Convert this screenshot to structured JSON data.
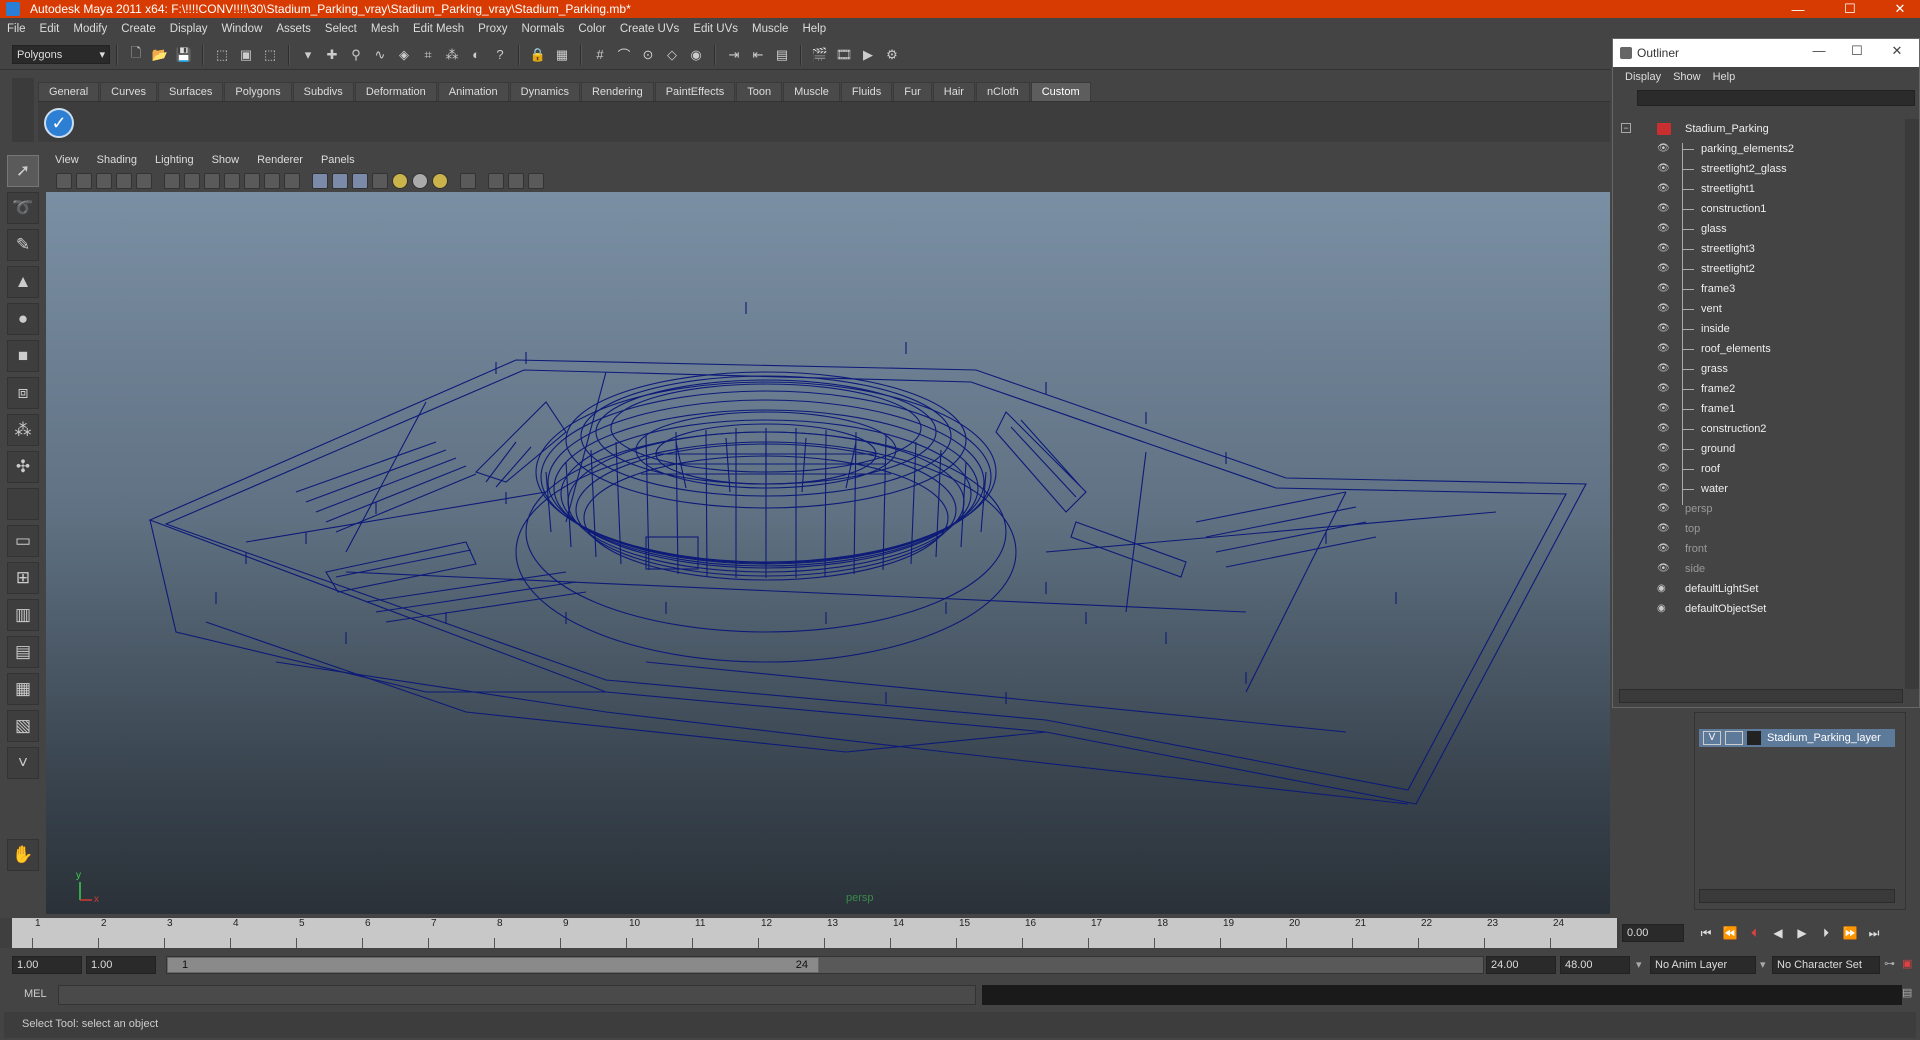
{
  "window": {
    "title": "Autodesk Maya 2011 x64: F:\\!!!!CONV!!!!\\30\\Stadium_Parking_vray\\Stadium_Parking_vray\\Stadium_Parking.mb*",
    "minimize": "—",
    "maximize": "☐",
    "close": "✕"
  },
  "menu": [
    "File",
    "Edit",
    "Modify",
    "Create",
    "Display",
    "Window",
    "Assets",
    "Select",
    "Mesh",
    "Edit Mesh",
    "Proxy",
    "Normals",
    "Color",
    "Create UVs",
    "Edit UVs",
    "Muscle",
    "Help"
  ],
  "status": {
    "mode": "Polygons"
  },
  "shelf": {
    "tabs": [
      "General",
      "Curves",
      "Surfaces",
      "Polygons",
      "Subdivs",
      "Deformation",
      "Animation",
      "Dynamics",
      "Rendering",
      "PaintEffects",
      "Toon",
      "Muscle",
      "Fluids",
      "Fur",
      "Hair",
      "nCloth",
      "Custom"
    ],
    "active": "Custom"
  },
  "panel": {
    "menu": [
      "View",
      "Shading",
      "Lighting",
      "Show",
      "Renderer",
      "Panels"
    ],
    "camera": "persp",
    "axis_y": "y",
    "axis_x": "x"
  },
  "timeline": {
    "ticks": [
      "1",
      "2",
      "3",
      "4",
      "5",
      "6",
      "7",
      "8",
      "9",
      "10",
      "11",
      "12",
      "13",
      "14",
      "15",
      "16",
      "17",
      "18",
      "19",
      "20",
      "21",
      "22",
      "23",
      "24"
    ],
    "current_time": "0.00"
  },
  "range": {
    "start": "1.00",
    "playback_start": "1.00",
    "handle_start": "1",
    "handle_end": "24",
    "playback_end": "24.00",
    "end": "48.00",
    "anim_layer": "No Anim Layer",
    "character_set": "No Character Set"
  },
  "command": {
    "label": "MEL",
    "help": "Select Tool: select an object"
  },
  "outliner": {
    "title": "Outliner",
    "window_min": "—",
    "window_max": "☐",
    "window_close": "✕",
    "menu": [
      "Display",
      "Show",
      "Help"
    ],
    "root": "Stadium_Parking",
    "children": [
      "parking_elements2",
      "streetlight2_glass",
      "streetlight1",
      "construction1",
      "glass",
      "streetlight3",
      "streetlight2",
      "frame3",
      "vent",
      "inside",
      "roof_elements",
      "grass",
      "frame2",
      "frame1",
      "construction2",
      "ground",
      "roof",
      "water"
    ],
    "cameras": [
      "persp",
      "top",
      "front",
      "side"
    ],
    "sets": [
      "defaultLightSet",
      "defaultObjectSet"
    ]
  },
  "layers": {
    "name": "Stadium_Parking_layer",
    "visible": "V"
  },
  "colors": {
    "titlebar": "#d83b01",
    "wire": "#0d1a78",
    "layer": "#5d7a9a"
  }
}
